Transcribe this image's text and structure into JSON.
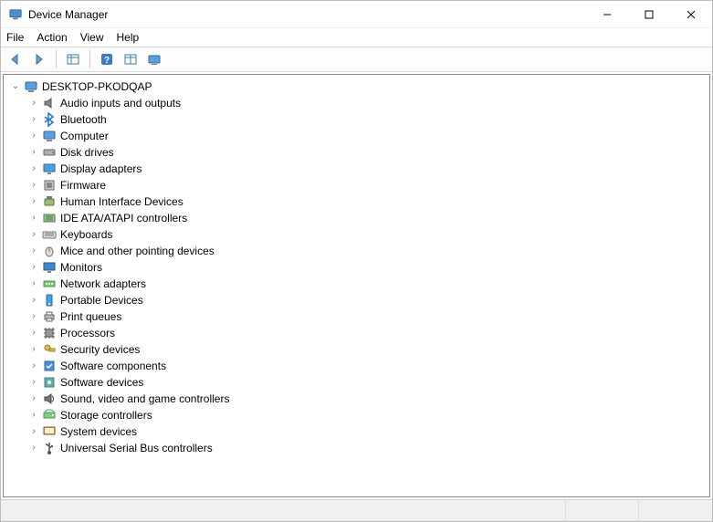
{
  "window": {
    "title": "Device Manager"
  },
  "menubar": {
    "file": "File",
    "action": "Action",
    "view": "View",
    "help": "Help"
  },
  "toolbar": {
    "back_icon": "back-icon",
    "forward_icon": "forward-icon",
    "properties_icon": "properties-icon",
    "help_icon": "help-icon",
    "show_hidden_icon": "show-hidden-icon",
    "scan_icon": "scan-icon"
  },
  "tree": {
    "root": {
      "label": "DESKTOP-PKODQAP",
      "icon": "computer-icon",
      "expanded": true
    },
    "items": [
      {
        "label": "Audio inputs and outputs",
        "icon": "audio-icon"
      },
      {
        "label": "Bluetooth",
        "icon": "bluetooth-icon"
      },
      {
        "label": "Computer",
        "icon": "computer-icon"
      },
      {
        "label": "Disk drives",
        "icon": "disk-icon"
      },
      {
        "label": "Display adapters",
        "icon": "display-icon"
      },
      {
        "label": "Firmware",
        "icon": "firmware-icon"
      },
      {
        "label": "Human Interface Devices",
        "icon": "hid-icon"
      },
      {
        "label": "IDE ATA/ATAPI controllers",
        "icon": "ide-icon"
      },
      {
        "label": "Keyboards",
        "icon": "keyboard-icon"
      },
      {
        "label": "Mice and other pointing devices",
        "icon": "mouse-icon"
      },
      {
        "label": "Monitors",
        "icon": "monitor-icon"
      },
      {
        "label": "Network adapters",
        "icon": "network-icon"
      },
      {
        "label": "Portable Devices",
        "icon": "portable-icon"
      },
      {
        "label": "Print queues",
        "icon": "printer-icon"
      },
      {
        "label": "Processors",
        "icon": "processor-icon"
      },
      {
        "label": "Security devices",
        "icon": "security-icon"
      },
      {
        "label": "Software components",
        "icon": "software-component-icon"
      },
      {
        "label": "Software devices",
        "icon": "software-device-icon"
      },
      {
        "label": "Sound, video and game controllers",
        "icon": "sound-icon"
      },
      {
        "label": "Storage controllers",
        "icon": "storage-icon"
      },
      {
        "label": "System devices",
        "icon": "system-icon"
      },
      {
        "label": "Universal Serial Bus controllers",
        "icon": "usb-icon"
      }
    ]
  }
}
